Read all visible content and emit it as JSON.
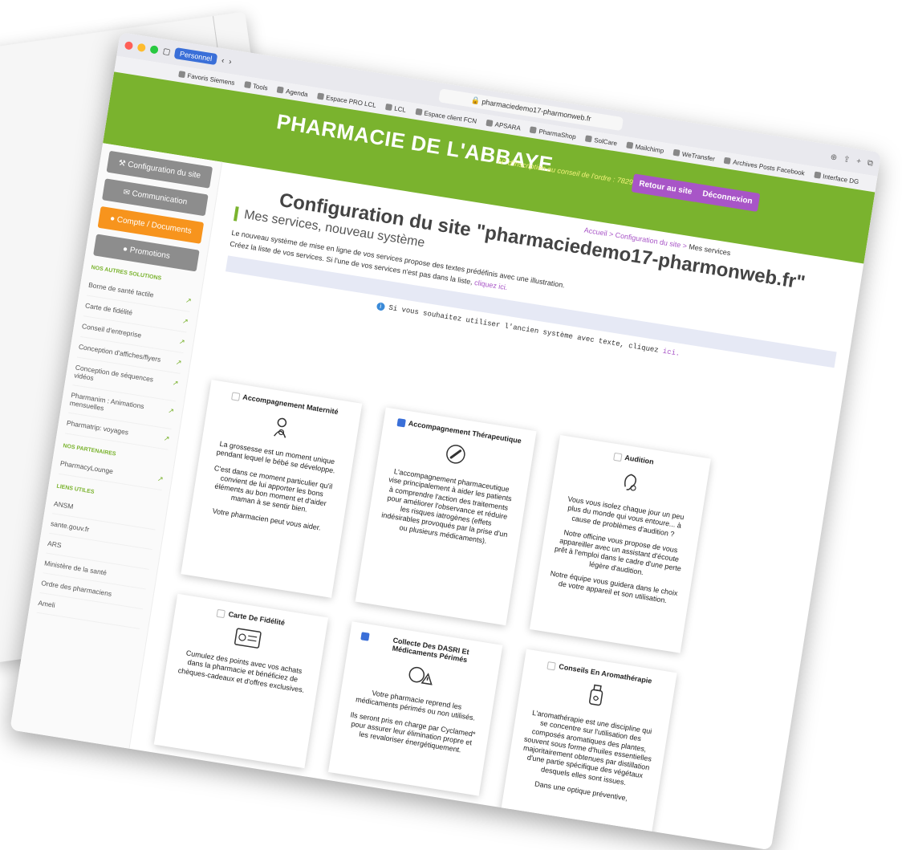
{
  "browser": {
    "profile": "Personnel",
    "url": "pharmaciedemo17-pharmonweb.fr",
    "bookmarks": [
      "Favoris Siemens",
      "Tools",
      "Agenda",
      "Espace PRO LCL",
      "LCL",
      "Espace client FCN",
      "APSARA",
      "PharmaShop",
      "SolCare",
      "Mailchimp",
      "WeTransfer",
      "Archives Posts Facebook",
      "Interface DG"
    ]
  },
  "header": {
    "brand": "PHARMACIE DE L'ABBAYE",
    "registration": "N° d'inscription au conseil de l'ordre : 782904",
    "back_button": "Retour au site",
    "logout_button": "Déconnexion"
  },
  "sidebar": {
    "buttons": [
      "Configuration du site",
      "Communication",
      "Compte / Documents",
      "Promotions"
    ],
    "active_index": 2,
    "sections": [
      {
        "title": "NOS AUTRES SOLUTIONS",
        "items": [
          "Borne de santé tactile",
          "Carte de fidélité",
          "Conseil d'entreprise",
          "Conception d'affiches/flyers",
          "Conception de séquences vidéos",
          "Pharmanim : Animations mensuelles",
          "Pharmatrip: voyages"
        ]
      },
      {
        "title": "NOS PARTENAIRES",
        "items": [
          "PharmacyLounge"
        ]
      },
      {
        "title": "LIENS UTILES",
        "items": [
          "ANSM",
          "sante.gouv.fr",
          "ARS",
          "Ministère de la santé",
          "Ordre des pharmaciens",
          "Ameli"
        ]
      }
    ]
  },
  "main": {
    "breadcrumb_link": "Accueil > Configuration du site >",
    "breadcrumb_current": "Mes services",
    "title": "Configuration du site \"pharmaciedemo17-pharmonweb.fr\"",
    "subtitle": "Mes services, nouveau système",
    "intro": "Le nouveau système de mise en ligne de vos services propose des textes prédéfinis avec une illustration.",
    "instruction": "Créez la liste de vos services. Si l'une de vos services n'est pas dans la liste,",
    "instruction_link": "cliquez ici.",
    "notice": "Si vous souhaitez utiliser l'ancien système avec texte, cliquez",
    "notice_link": "ici."
  },
  "cards": [
    {
      "title": "Accompagnement Maternité",
      "checked": false,
      "icon": "pregnancy-icon",
      "paragraphs": [
        "La grossesse est un moment unique pendant lequel le bébé se développe.",
        "C'est dans ce moment particulier qu'il convient de lui apporter les bons éléments au bon moment et d'aider maman à se sentir bien.",
        "Votre pharmacien peut vous aider."
      ]
    },
    {
      "title": "Accompagnement Thérapeutique",
      "checked": true,
      "icon": "therapy-icon",
      "paragraphs": [
        "L'accompagnement pharmaceutique vise principalement à aider les patients à comprendre l'action des traitements pour améliorer l'observance et réduire les risques iatrogènes (effets indésirables provoqués par la prise d'un ou plusieurs médicaments)."
      ]
    },
    {
      "title": "Audition",
      "checked": false,
      "icon": "hearing-icon",
      "paragraphs": [
        "Vous vous isolez chaque jour un peu plus du monde qui vous entoure... à cause de problèmes d'audition ?",
        "Notre officine vous propose de vous appareiller avec un assistant d'écoute prêt à l'emploi dans le cadre d'une perte légère d'audition.",
        "Notre équipe vous guidera dans le choix de votre appareil et son utilisation."
      ]
    },
    {
      "title": "Carte De Fidélité",
      "checked": false,
      "icon": "loyalty-card-icon",
      "paragraphs": [
        "Cumulez des points avec vos achats dans la pharmacie et bénéficiez de chèques-cadeaux et d'offres exclusives."
      ]
    },
    {
      "title": "Collecte Des DASRI Et Médicaments Périmés",
      "checked": true,
      "icon": "waste-collection-icon",
      "paragraphs": [
        "Votre pharmacie reprend les médicaments périmés ou non utilisés.",
        "Ils seront pris en charge par Cyclamed* pour assurer leur élimination propre et les revaloriser énergétiquement."
      ]
    },
    {
      "title": "Conseils En Aromathérapie",
      "checked": false,
      "icon": "aroma-bottle-icon",
      "paragraphs": [
        "L'aromathérapie est une discipline qui se concentre sur l'utilisation des composés aromatiques des plantes, souvent sous forme d'huiles essentielles majoritairement obtenues par distillation d'une partie spécifique des végétaux desquels elles sont issues.",
        "Dans une optique préventive,"
      ]
    }
  ]
}
